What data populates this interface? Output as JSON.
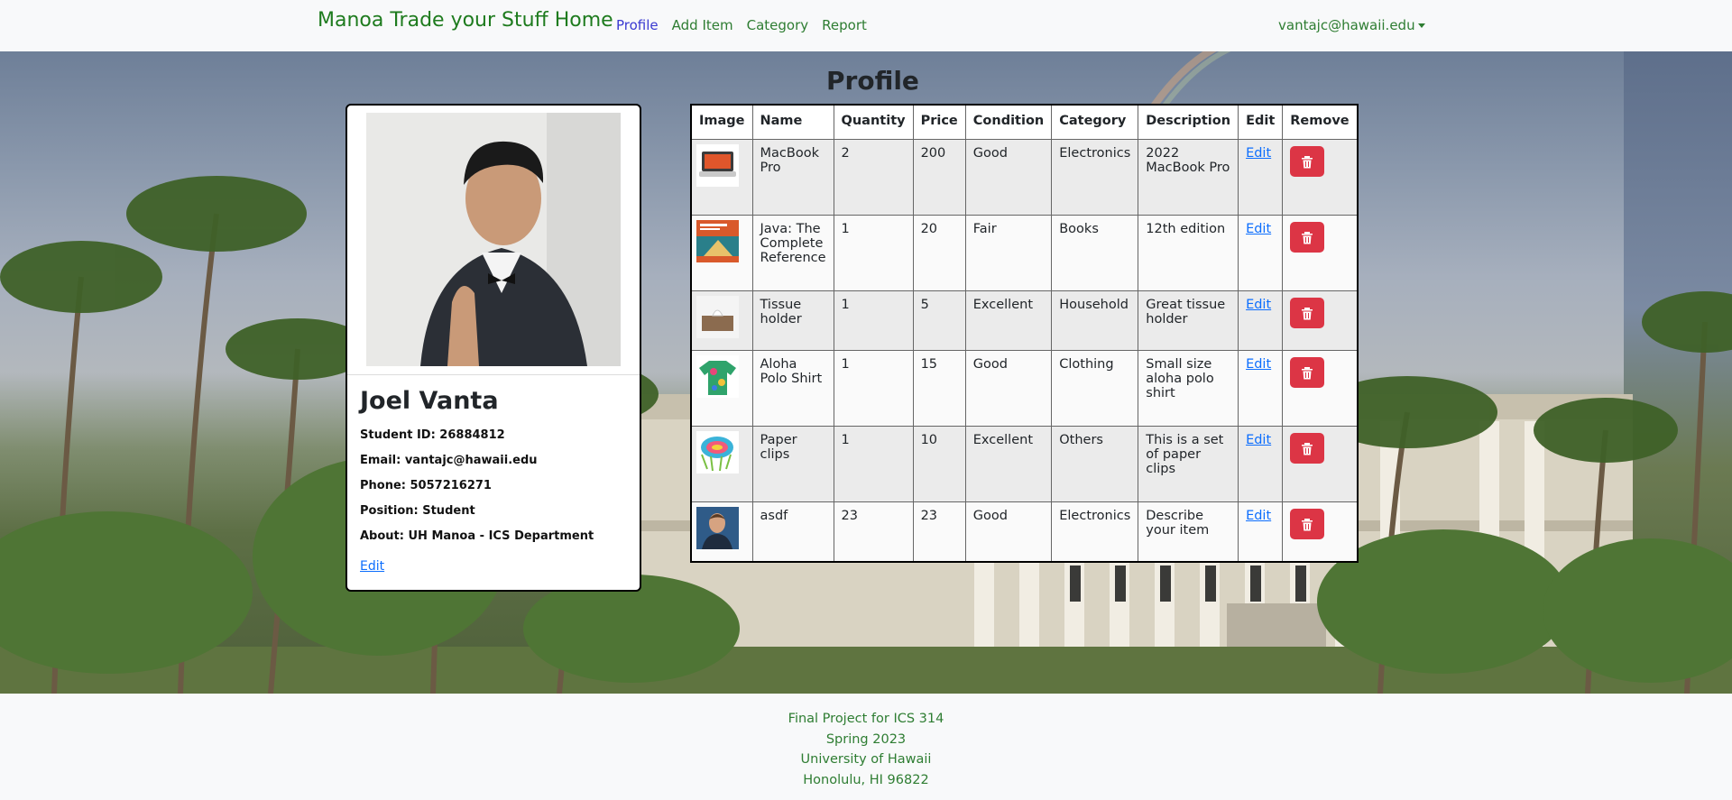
{
  "nav": {
    "brand": "Manoa Trade your Stuff Home",
    "links": [
      "Profile",
      "Add Item",
      "Category",
      "Report"
    ],
    "user": "vantajc@hawaii.edu"
  },
  "profile_card": {
    "name": "Joel Vanta",
    "student_id": "Student ID: 26884812",
    "email": "Email: vantajc@hawaii.edu",
    "phone": "Phone: 5057216271",
    "position": "Position: Student",
    "about": "About: UH Manoa - ICS Department",
    "edit_label": "Edit"
  },
  "page_title": "Profile",
  "table": {
    "headers": [
      "Image",
      "Name",
      "Quantity",
      "Price",
      "Condition",
      "Category",
      "Description",
      "Edit",
      "Remove"
    ],
    "rows": [
      {
        "image": "laptop",
        "name": "MacBook Pro",
        "quantity": "2",
        "price": "200",
        "condition": "Good",
        "category": "Electronics",
        "description": "2022 MacBook Pro",
        "edit": "Edit"
      },
      {
        "image": "book",
        "name": "Java: The Complete Reference",
        "quantity": "1",
        "price": "20",
        "condition": "Fair",
        "category": "Books",
        "description": "12th edition",
        "edit": "Edit"
      },
      {
        "image": "tissue",
        "name": "Tissue holder",
        "quantity": "1",
        "price": "5",
        "condition": "Excellent",
        "category": "Household",
        "description": "Great tissue holder",
        "edit": "Edit"
      },
      {
        "image": "shirt",
        "name": "Aloha Polo Shirt",
        "quantity": "1",
        "price": "15",
        "condition": "Good",
        "category": "Clothing",
        "description": "Small size aloha polo shirt",
        "edit": "Edit"
      },
      {
        "image": "clips",
        "name": "Paper clips",
        "quantity": "1",
        "price": "10",
        "condition": "Excellent",
        "category": "Others",
        "description": "This is a set of paper clips",
        "edit": "Edit"
      },
      {
        "image": "person",
        "name": "asdf",
        "quantity": "23",
        "price": "23",
        "condition": "Good",
        "category": "Electronics",
        "description": "Describe your item",
        "edit": "Edit"
      }
    ]
  },
  "footer": {
    "lines": [
      "Final Project for ICS 314",
      "Spring 2023",
      "University of Hawaii",
      "Honolulu, HI 96822"
    ]
  },
  "colors": {
    "brand_green": "#1e7b1e",
    "link_green": "#2e7d32",
    "active_link": "#3a3ad1",
    "danger": "#dc3545",
    "link_blue": "#0d6efd"
  }
}
